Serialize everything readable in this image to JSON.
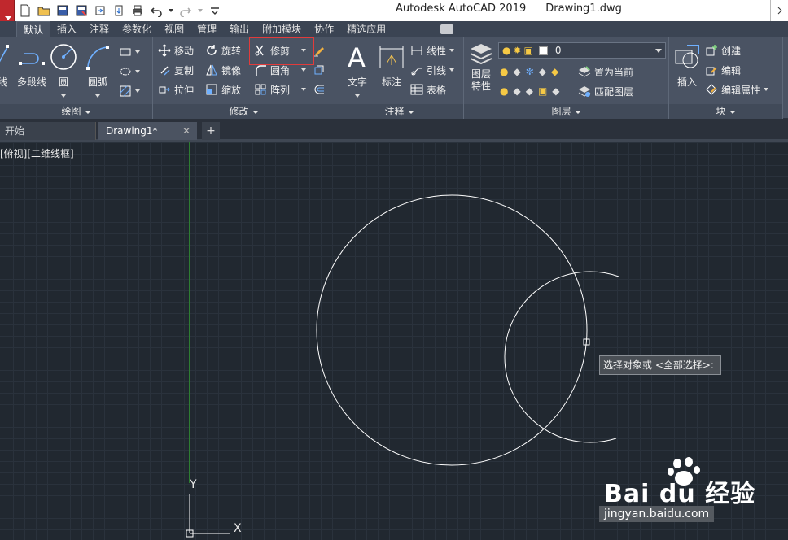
{
  "titlebar": {
    "app_name": "Autodesk AutoCAD 2019",
    "document": "Drawing1.dwg"
  },
  "ribbon_tabs": [
    "默认",
    "插入",
    "注释",
    "参数化",
    "视图",
    "管理",
    "输出",
    "附加模块",
    "协作",
    "精选应用"
  ],
  "active_tab": "默认",
  "draw_panel": {
    "title": "绘图",
    "line_label": "线",
    "polyline_label": "多段线",
    "circle_label": "圆",
    "arc_label": "圆弧"
  },
  "modify_panel": {
    "title": "修改",
    "move": "移动",
    "rotate": "旋转",
    "trim": "修剪",
    "copy": "复制",
    "mirror": "镜像",
    "fillet": "圆角",
    "stretch": "拉伸",
    "scale": "缩放",
    "array": "阵列"
  },
  "annotation_panel": {
    "title": "注释",
    "text": "文字",
    "dimension": "标注",
    "linear": "线性",
    "leader": "引线",
    "table": "表格"
  },
  "layers_panel": {
    "title": "图层",
    "properties": "图层\n特性",
    "current_layer": "0",
    "set_current": "置为当前",
    "match_layer": "匹配图层"
  },
  "block_panel": {
    "title": "块",
    "insert": "插入",
    "create": "创建",
    "edit": "编辑",
    "edit_attributes": "编辑属性"
  },
  "file_tabs": {
    "start": "开始",
    "document": "Drawing1*",
    "new_tab": "+"
  },
  "viewport": {
    "label": "[俯视][二维线框]"
  },
  "prompt_tooltip": "选择对象或 <全部选择>:",
  "ucs": {
    "x_label": "X",
    "y_label": "Y"
  },
  "watermark": {
    "logo": "Bai du 经验",
    "url": "jingyan.baidu.com"
  },
  "colors": {
    "canvas_bg": "#212830",
    "ribbon_bg": "#4a5363",
    "highlight": "#e23b3b",
    "y_axis": "#2e7d32"
  }
}
